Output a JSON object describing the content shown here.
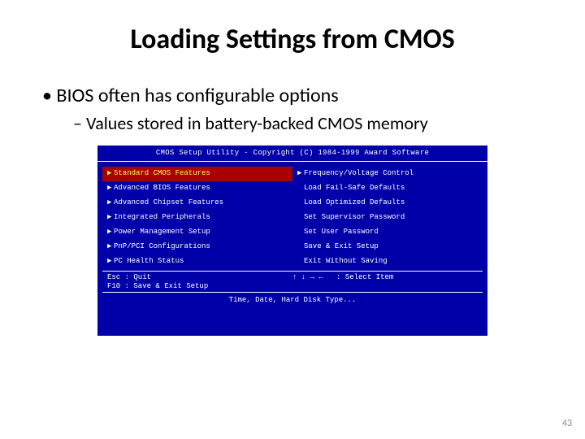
{
  "title": "Loading Settings from CMOS",
  "bullet": "BIOS often has configurable options",
  "subbullet": "Values stored in battery-backed CMOS memory",
  "bios": {
    "header": "CMOS Setup Utility - Copyright (C) 1984-1999 Award Software",
    "left_items": [
      {
        "tri": true,
        "label": "Standard CMOS Features",
        "selected": true
      },
      {
        "tri": true,
        "label": "Advanced BIOS Features",
        "selected": false
      },
      {
        "tri": true,
        "label": "Advanced Chipset Features",
        "selected": false
      },
      {
        "tri": true,
        "label": "Integrated Peripherals",
        "selected": false
      },
      {
        "tri": true,
        "label": "Power Management Setup",
        "selected": false
      },
      {
        "tri": true,
        "label": "PnP/PCI Configurations",
        "selected": false
      },
      {
        "tri": true,
        "label": "PC Health Status",
        "selected": false
      }
    ],
    "right_items": [
      {
        "tri": true,
        "label": "Frequency/Voltage Control",
        "selected": false
      },
      {
        "tri": false,
        "label": "Load Fail-Safe Defaults",
        "selected": false
      },
      {
        "tri": false,
        "label": "Load Optimized Defaults",
        "selected": false
      },
      {
        "tri": false,
        "label": "Set Supervisor Password",
        "selected": false
      },
      {
        "tri": false,
        "label": "Set User Password",
        "selected": false
      },
      {
        "tri": false,
        "label": "Save & Exit Setup",
        "selected": false
      },
      {
        "tri": false,
        "label": "Exit Without Saving",
        "selected": false
      }
    ],
    "help_left": "Esc : Quit\nF10 : Save & Exit Setup",
    "help_right": "↑ ↓ → ←   : Select Item",
    "footer": "Time, Date, Hard Disk Type..."
  },
  "page_number": "43"
}
